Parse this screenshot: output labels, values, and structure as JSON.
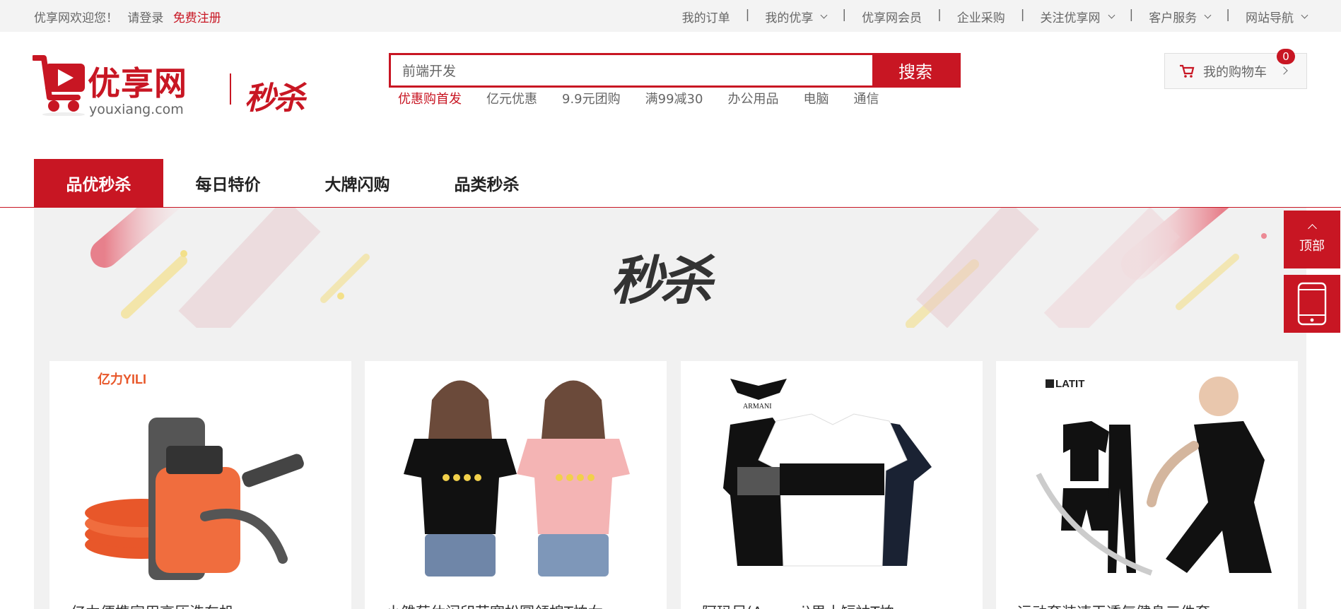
{
  "topbar": {
    "welcome": "优享网欢迎您！",
    "login": "请登录",
    "register": "免费注册",
    "links": [
      "我的订单",
      "我的优享",
      "优享网会员",
      "企业采购",
      "关注优享网",
      "客户服务",
      "网站导航"
    ]
  },
  "logo": {
    "brand": "优享网",
    "domain": "youxiang.com",
    "sub": "秒杀"
  },
  "search": {
    "value": "前端开发",
    "button": "搜索",
    "hotwords": [
      "优惠购首发",
      "亿元优惠",
      "9.9元团购",
      "满99减30",
      "办公用品",
      "电脑",
      "通信"
    ]
  },
  "cart": {
    "label": "我的购物车",
    "count": "0"
  },
  "nav": {
    "tabs": [
      "品优秒杀",
      "每日特价",
      "大牌闪购",
      "品类秒杀"
    ]
  },
  "banner": {
    "title": "秒杀"
  },
  "side": {
    "top": "顶部"
  },
  "products": [
    {
      "title": "亿力便携家用高压洗车机",
      "brand": "亿力YILI"
    },
    {
      "title": "小雏菊休闲印花宽松圆领棉T恤女",
      "brand": ""
    },
    {
      "title": "阿玛尼(Armani)男士短袖T恤",
      "brand": "ARMANI"
    },
    {
      "title": "运动套装速干透气健身三件套",
      "brand": "LATIT"
    }
  ],
  "colors": {
    "accent": "#c81623",
    "topbar_bg": "#f3f3f3",
    "main_bg": "#f1f1f1"
  }
}
